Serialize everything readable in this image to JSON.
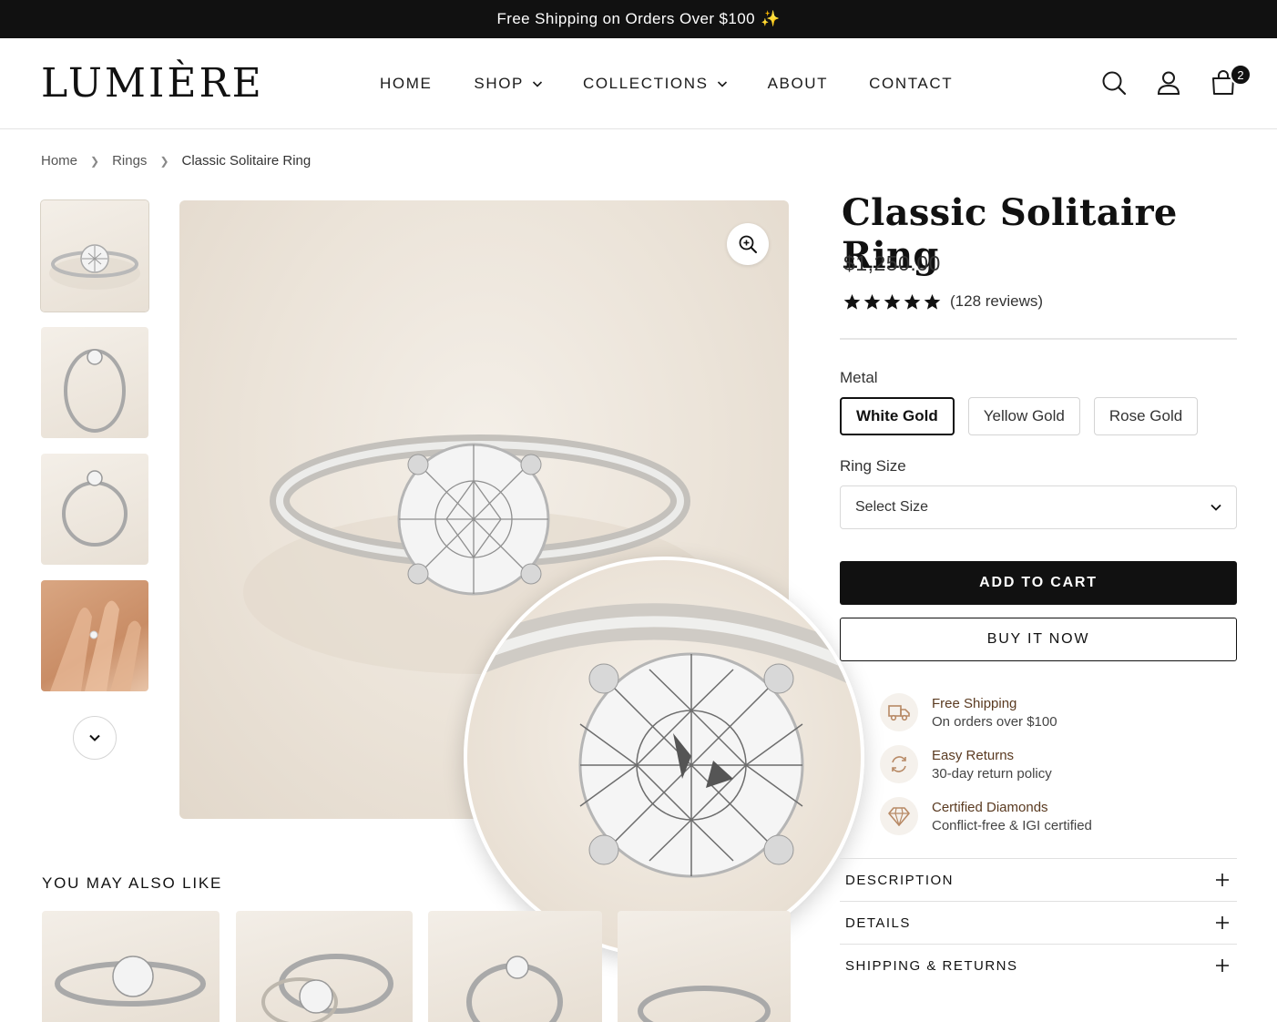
{
  "announcement": {
    "text": "Free Shipping on Orders Over $100",
    "emoji": "✨"
  },
  "header": {
    "logo": "LUMIÈRE",
    "nav": [
      {
        "label": "HOME",
        "dropdown": false
      },
      {
        "label": "SHOP",
        "dropdown": true
      },
      {
        "label": "COLLECTIONS",
        "dropdown": true
      },
      {
        "label": "ABOUT",
        "dropdown": false
      },
      {
        "label": "CONTACT",
        "dropdown": false
      }
    ],
    "icons": [
      "search-icon",
      "account-icon",
      "cart-icon"
    ],
    "cart_count": "2"
  },
  "breadcrumb": {
    "items": [
      "Home",
      "Rings"
    ],
    "current": "Classic Solitaire Ring"
  },
  "gallery": {
    "thumbnails": [
      "ring-top-view",
      "ring-side-view",
      "ring-front-view",
      "ring-on-hand"
    ],
    "main_image": "solitaire-ring-photo",
    "zoom_icon": "zoom-icon"
  },
  "product": {
    "title": "Classic Solitaire Ring",
    "price": "$1,250.00",
    "rating": 5,
    "reviews": "(128 reviews)",
    "metal_label": "Metal",
    "metals": [
      "White Gold",
      "Yellow Gold",
      "Rose Gold"
    ],
    "metal_selected": "White Gold",
    "size_label": "Ring Size",
    "size_placeholder": "Select Size",
    "add_to_cart": "ADD TO CART",
    "buy_now": "BUY IT NOW"
  },
  "features": [
    {
      "icon": "truck-icon",
      "title": "Free Shipping",
      "sub": "On orders over $100"
    },
    {
      "icon": "returns-icon",
      "title": "Easy Returns",
      "sub": "30-day return policy"
    },
    {
      "icon": "diamond-icon",
      "title": "Certified Diamonds",
      "sub": "Conflict-free & IGI certified"
    }
  ],
  "accordion": [
    "DESCRIPTION",
    "DETAILS",
    "SHIPPING & RETURNS"
  ],
  "also_like": {
    "heading": "YOU MAY ALSO LIKE"
  },
  "colors": {
    "black": "#111111",
    "accent_brown": "#5a3a20",
    "cream": "#f4efe8"
  }
}
